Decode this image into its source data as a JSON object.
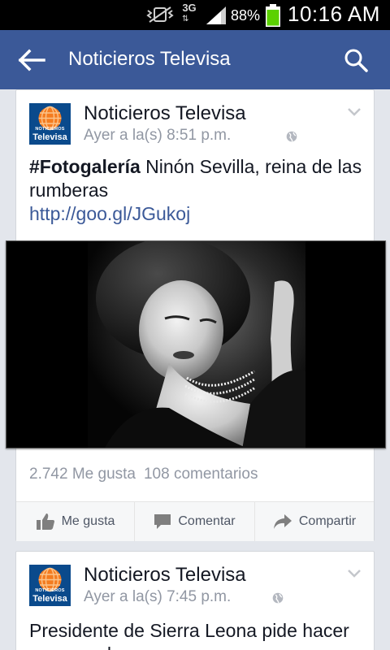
{
  "status_bar": {
    "network": "3G",
    "battery": "88%",
    "time": "10:16 AM"
  },
  "app_bar": {
    "title": "Noticieros Televisa",
    "back_icon": "arrow-left-icon",
    "search_icon": "search-icon"
  },
  "colors": {
    "brand_blue": "#3b5998",
    "battery_green": "#5bd100",
    "logo_orange": "#f47c20"
  },
  "posts": [
    {
      "page_name": "Noticieros Televisa",
      "logo_text_small": "NOTICIEROS",
      "logo_text_big": "Televisa",
      "timestamp": "Ayer a la(s) 8:51 p.m.",
      "hashtag": "#Fotogalería",
      "text": " Ninón Sevilla, reina de las rumberas",
      "link": "http://goo.gl/JGukoj",
      "likes": "2.742 Me gusta",
      "comments": "108 comentarios",
      "actions": {
        "like": "Me gusta",
        "comment": "Comentar",
        "share": "Compartir"
      }
    },
    {
      "page_name": "Noticieros Televisa",
      "logo_text_small": "NOTICIEROS",
      "logo_text_big": "Televisa",
      "timestamp": "Ayer a la(s) 7:45 p.m.",
      "text": "Presidente de Sierra Leona pide hacer semana de ayuno y"
    }
  ]
}
